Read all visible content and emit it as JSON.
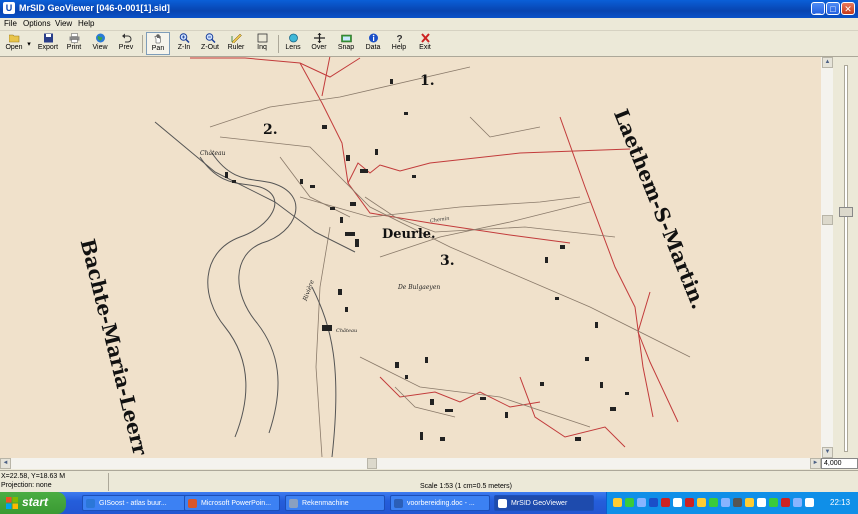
{
  "window": {
    "app_icon": "U",
    "title": "MrSID GeoViewer  [046-0-001[1].sid]",
    "minimize_glyph": "_",
    "maximize_glyph": "□",
    "close_glyph": "✕"
  },
  "menu": [
    "File",
    "Options",
    "View",
    "Help"
  ],
  "toolbar": {
    "open": "Open",
    "export": "Export",
    "print": "Print",
    "view": "View",
    "prev": "Prev",
    "pan": "Pan",
    "zin": "Z-In",
    "zout": "Z-Out",
    "ruler": "Ruler",
    "inq": "Inq",
    "lens": "Lens",
    "over": "Over",
    "snap": "Snap",
    "data": "Data",
    "help": "Help",
    "exit": "Exit",
    "active_tool": "Pan"
  },
  "map": {
    "labels": {
      "municipality_left": "Bachte-Maria-Leerr",
      "municipality_right": "Laethem-S-Martin.",
      "village": "Deurle.",
      "section_1": "1.",
      "section_2": "2.",
      "section_3": "3.",
      "chateau_1": "Château",
      "chateau_2": "Château",
      "bulgaeyen": "De Bulgaeyen",
      "river": "Rivière",
      "chemin": "Chemin"
    },
    "colors": {
      "paper": "#f0e1cb",
      "ink": "#222222",
      "boundary_red": "#c23b3b",
      "road": "#8a7a6a",
      "river": "#555555"
    }
  },
  "scroll": {
    "up": "▲",
    "down": "▼",
    "left": "◄",
    "right": "►"
  },
  "scale_value": "4,000",
  "status": {
    "coords": "X=22.58, Y=18.63 M",
    "projection": "Projection: none",
    "scale": "Scale 1:53 (1 cm=0.5 meters)"
  },
  "taskbar": {
    "start": "start",
    "tasks": [
      {
        "label": "GISoost - atlas buur...",
        "color": "#2b77d8"
      },
      {
        "label": "Microsoft PowerPoin...",
        "color": "#d8562b"
      },
      {
        "label": "Rekenmachine",
        "color": "#8aa0c0"
      },
      {
        "label": "voorbereiding.doc - ...",
        "color": "#2b5fb8"
      },
      {
        "label": "MrSID GeoViewer",
        "color": "#ffffff"
      }
    ],
    "clock": "22:13"
  }
}
